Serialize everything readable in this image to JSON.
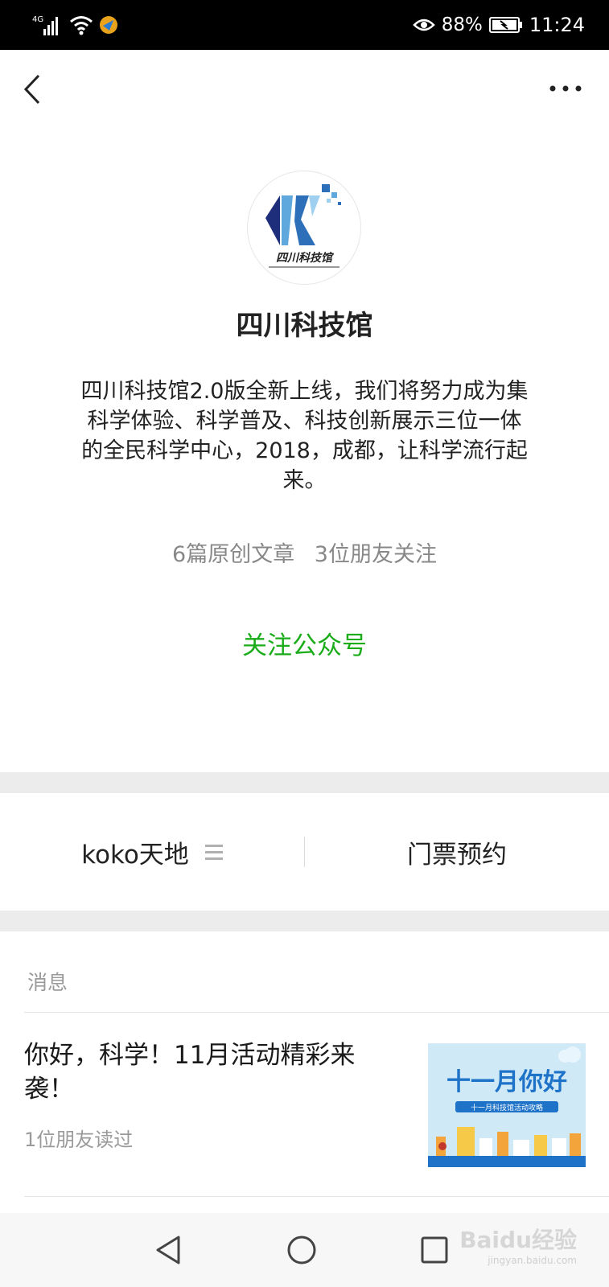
{
  "status_bar": {
    "network": "4G",
    "battery_percent": "88%",
    "time": "11:24"
  },
  "account": {
    "logo_text": "四川科技馆",
    "name": "四川科技馆",
    "description": "四川科技馆2.0版全新上线，我们将努力成为集科学体验、科学普及、科技创新展示三位一体的全民科学中心，2018，成都，让科学流行起来。",
    "stats_articles": "6篇原创文章",
    "stats_friends": "3位朋友关注",
    "follow_label": "关注公众号"
  },
  "menu": {
    "left_label": "koko天地",
    "right_label": "门票预约"
  },
  "messages": {
    "header": "消息",
    "items": [
      {
        "title": "你好，科学！11月活动精彩来袭！",
        "meta": "1位朋友读过",
        "thumb_title": "十一月你好",
        "thumb_subtitle": "十一月科技馆活动攻略"
      }
    ]
  },
  "watermark": {
    "brand": "Baidu经验",
    "url": "jingyan.baidu.com"
  },
  "colors": {
    "follow_green": "#1aad19",
    "thumb_blue": "#1e73c8"
  }
}
